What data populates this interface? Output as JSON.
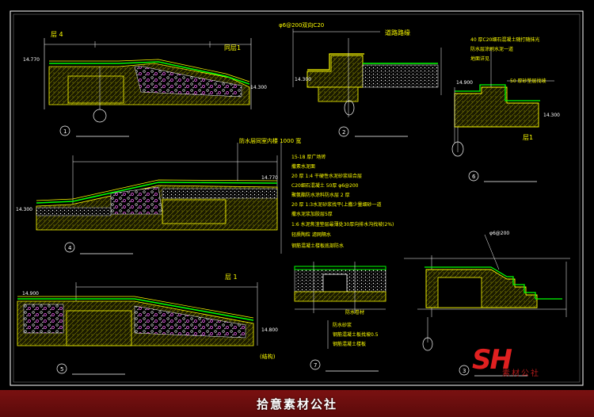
{
  "colors": {
    "background": "#000000",
    "frame": "#ffffff",
    "yellow": "#ffff00",
    "green": "#00ff00",
    "magenta": "#ff66ff",
    "cyan": "#00ffff",
    "red": "#ff3030",
    "banner": "#6a0e0e",
    "logo": "#e02020"
  },
  "labels": {
    "layer_a": "层 4",
    "same_layer": "同层1",
    "elev_a_left": "14.770",
    "elev_a_right": "14.300",
    "circle_1": "1",
    "label_b_top": "φ6@200双向C20",
    "label_b_right": "道路路缘",
    "elev_b": "14.300",
    "circle_2": "2",
    "label_c_1": "40 厚C20细石混凝土随打随抹光",
    "label_c_2": "防水层涂刷水泥一道",
    "label_c_3": "地面详见",
    "label_c_4": "50 厚砂垫层找坡",
    "elev_c_left": "14.900",
    "elev_c_right": "14.300",
    "layer_c": "层1",
    "circle_6": "6",
    "label_d_top": "防水层同室内楼 1000 宽",
    "elev_d_left": "14.300",
    "elev_d_right": "14.770",
    "circle_4": "4",
    "spec_lines": [
      "15-18 厚广场砖",
      "撒素水泥面",
      "20 厚 1:4 干硬性水泥砂浆结合层",
      "C20细石混凝土 50厚 φ6@200",
      "聚氨酯防水涂料防水层 2 厚",
      "20 厚 1:3水泥砂浆找平(上撒少量细砂一道",
      "撒水泥浆加胶层5厚",
      "1:6 水泥焦渣垫层最薄处30厚向排水沟找坡(2%)",
      "轻质陶粒 滤网隔水",
      "钢筋混凝土楼板底部防水"
    ],
    "label_e_1": "防水砂浆",
    "label_e_2": "钢筋混凝土板找坡0.5",
    "label_e_3": "钢筋混凝土楼板",
    "label_e_4": "防水卷材",
    "circle_7": "7",
    "elev_f_left": "14.900",
    "elev_f_right": "14.800",
    "layer_f": "层 1",
    "label_f_note": "(结构)",
    "circle_5": "5",
    "label_g_top": "φ6@200",
    "circle_3": "3",
    "logo_text": "SH",
    "logo_sub": "素材公社"
  },
  "footer": {
    "text": "拾意素材公社"
  }
}
